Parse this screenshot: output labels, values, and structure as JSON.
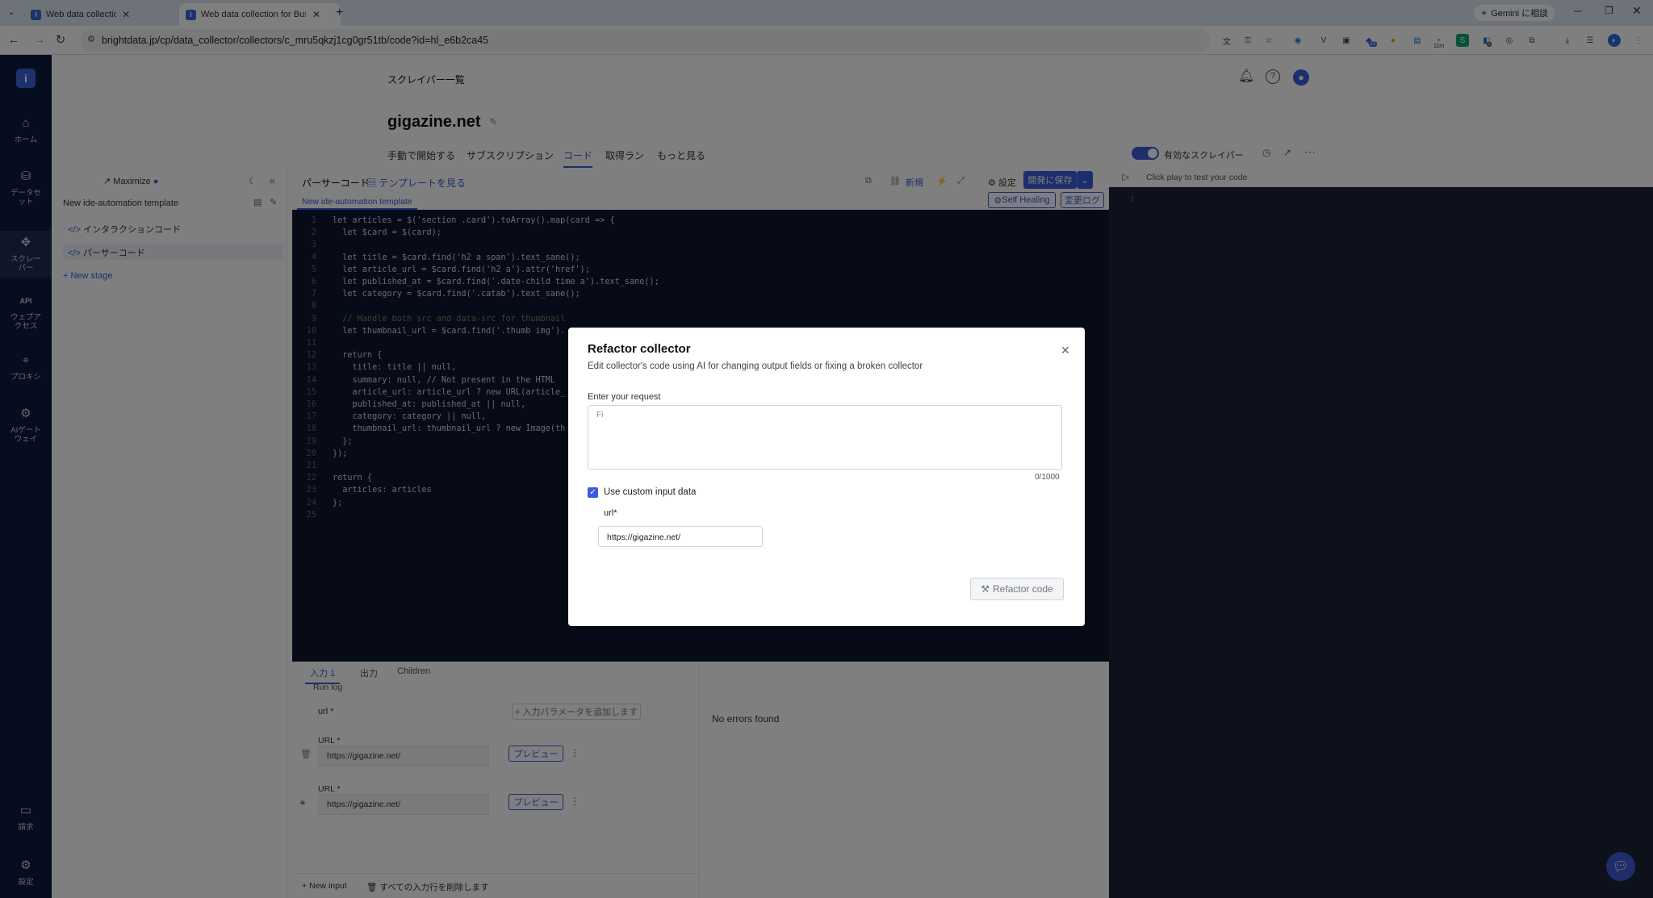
{
  "browser": {
    "tabs": [
      {
        "title": "Web data collection for Business",
        "active": false
      },
      {
        "title": "Web data collection for Business",
        "active": true
      }
    ],
    "url": "brightdata.jp/cp/data_collector/collectors/c_mru5qkzj1cg0gr51tb/code?id=hl_e6b2ca45",
    "gemini_label": "Gemini に相談",
    "ext_badges": {
      "badge1": "22",
      "badge2": "11m",
      "badge3": "2"
    }
  },
  "nav": {
    "logo": "i",
    "items": [
      {
        "label": "ホーム",
        "icon": "home-icon"
      },
      {
        "label": "データセット",
        "icon": "dataset-icon"
      },
      {
        "label": "スクレーパー",
        "icon": "scraper-icon"
      },
      {
        "label": "ウェブアクセス",
        "icon": "api-icon",
        "glyph": "API"
      },
      {
        "label": "プロキシ",
        "icon": "proxy-icon"
      },
      {
        "label": "AIゲートウェイ",
        "icon": "ai-gateway-icon"
      },
      {
        "label": "請求",
        "icon": "billing-icon"
      },
      {
        "label": "設定",
        "icon": "settings-icon"
      }
    ]
  },
  "header": {
    "breadcrumb": "スクレイパー一覧",
    "title": "gigazine.net",
    "tabs": [
      "手動で開始する",
      "サブスクリプション",
      "コード",
      "取得ラン",
      "もっと見る"
    ],
    "active_tab": "コード",
    "toggle_label": "有効なスクレイパー"
  },
  "sidebar": {
    "maximize": "Maximize",
    "template_name": "New ide-automation template",
    "items": [
      "インタラクションコード",
      "パーサーコード"
    ],
    "new_stage": "+ New stage"
  },
  "editor": {
    "title": "パーサーコード",
    "template_link": "テンプレートを見る",
    "new_label": "新規",
    "settings_label": "設定",
    "save_button": "開発に保存",
    "file_tab": "New ide-automation template",
    "self_healing": "Self Healing",
    "changelog": "変更ログ",
    "lines": [
      "let articles = $('section .card').toArray().map(card => {",
      "  let $card = $(card);",
      "",
      "  let title = $card.find('h2 a span').text_sane();",
      "  let article_url = $card.find('h2 a').attr('href');",
      "  let published_at = $card.find('.date-child time a').text_sane();",
      "  let category = $card.find('.catab').text_sane();",
      "",
      "  // Handle both src and data-src for thumbnail",
      "  let thumbnail_url = $card.find('.thumb img').",
      "",
      "  return {",
      "    title: title || null,",
      "    summary: null, // Not present in the HTML",
      "    article_url: article_url ? new URL(article_",
      "    published_at: published_at || null,",
      "    category: category || null,",
      "    thumbnail_url: thumbnail_url ? new Image(th",
      "  };",
      "});",
      "",
      "return {",
      "  articles: articles",
      "};",
      ""
    ]
  },
  "bottom": {
    "tabs": [
      "入力",
      "出力",
      "Children"
    ],
    "input_count": "1",
    "run_log": "Run log",
    "url_header": "url *",
    "add_param": "+ 入力パラメータを追加します",
    "rows": [
      {
        "label": "URL *",
        "value": "https://gigazine.net/",
        "preview": "プレビュー"
      },
      {
        "label": "URL *",
        "value": "https://gigazine.net/",
        "preview": "プレビュー"
      }
    ],
    "no_errors": "No errors found",
    "new_input": "+ New input",
    "delete_all": "すべての入力行を削除します"
  },
  "right_panel": {
    "hint": "Click play to test your code",
    "line": "1"
  },
  "modal": {
    "title": "Refactor collector",
    "subtitle": "Edit collector's code using AI for changing output fields or fixing a broken collector",
    "request_label": "Enter your request",
    "request_value": "Fi",
    "counter": "0/1000",
    "checkbox_label": "Use custom input data",
    "checkbox_checked": true,
    "url_label": "url*",
    "url_value": "https://gigazine.net/",
    "submit": "Refactor code"
  },
  "colors": {
    "nav_bg": "#0d1b3e",
    "editor_bg": "#0f1730",
    "accent": "#3b5bdb"
  }
}
